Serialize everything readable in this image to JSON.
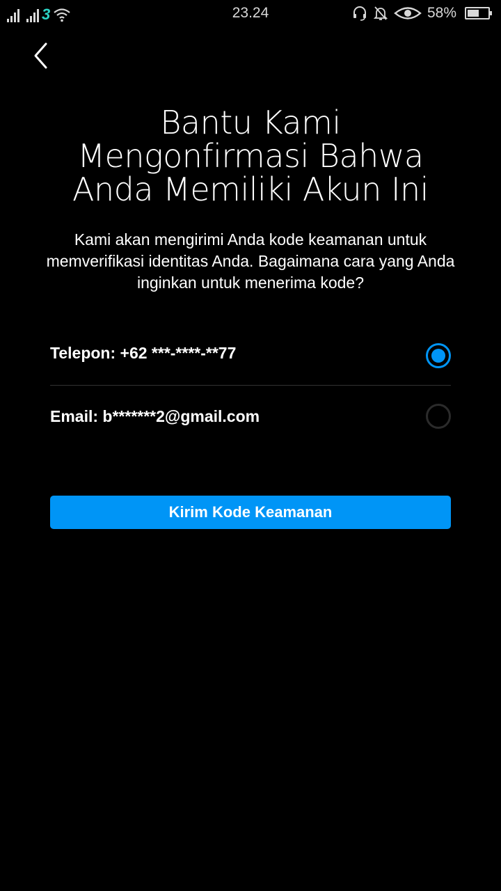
{
  "status_bar": {
    "carrier": "3",
    "time": "23.24",
    "battery": "58%",
    "battery_level": 0.58,
    "icons": [
      "signal-icon",
      "signal-icon",
      "carrier-icon",
      "wifi-icon",
      "headset-icon",
      "mute-icon",
      "eye-icon",
      "battery-icon"
    ]
  },
  "header": {
    "back_icon": "chevron-left-icon"
  },
  "main": {
    "title": "Bantu Kami Mengonfirmasi Bahwa Anda Memiliki Akun Ini",
    "subtitle": "Kami akan mengirimi Anda kode keamanan untuk memverifikasi identitas Anda. Bagaimana cara yang Anda inginkan untuk menerima kode?",
    "options": [
      {
        "label": "Telepon: +62 ***-****-**77",
        "selected": true
      },
      {
        "label": "Email: b*******2@gmail.com",
        "selected": false
      }
    ],
    "send_button": "Kirim Kode Keamanan"
  },
  "colors": {
    "accent": "#0095f6",
    "background": "#000000",
    "text": "#ffffff"
  }
}
